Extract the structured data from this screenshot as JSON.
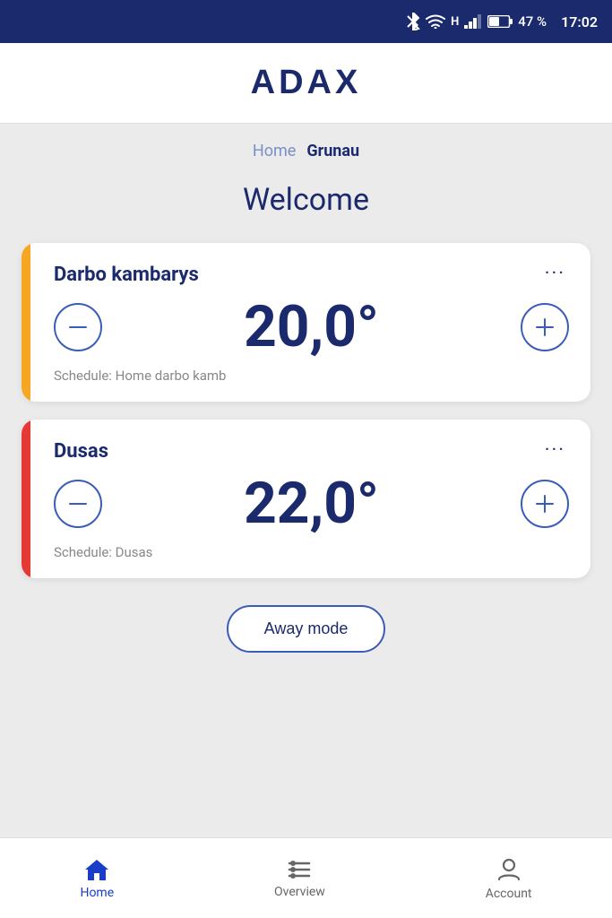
{
  "statusBar": {
    "battery": "47 %",
    "time": "17:02"
  },
  "header": {
    "logo": "ADAX"
  },
  "breadcrumb": {
    "home": "Home",
    "current": "Grunau"
  },
  "welcome": "Welcome",
  "cards": [
    {
      "id": "darbo",
      "name": "Darbo kambarys",
      "temperature": "20,0°",
      "schedule": "Schedule: Home darbo kamb",
      "accentClass": "card-accent-yellow"
    },
    {
      "id": "dusas",
      "name": "Dusas",
      "temperature": "22,0°",
      "schedule": "Schedule: Dusas",
      "accentClass": "card-accent-red"
    }
  ],
  "awayModeButton": "Away mode",
  "bottomNav": {
    "items": [
      {
        "id": "home",
        "label": "Home",
        "active": true
      },
      {
        "id": "overview",
        "label": "Overview",
        "active": false
      },
      {
        "id": "account",
        "label": "Account",
        "active": false
      }
    ]
  }
}
